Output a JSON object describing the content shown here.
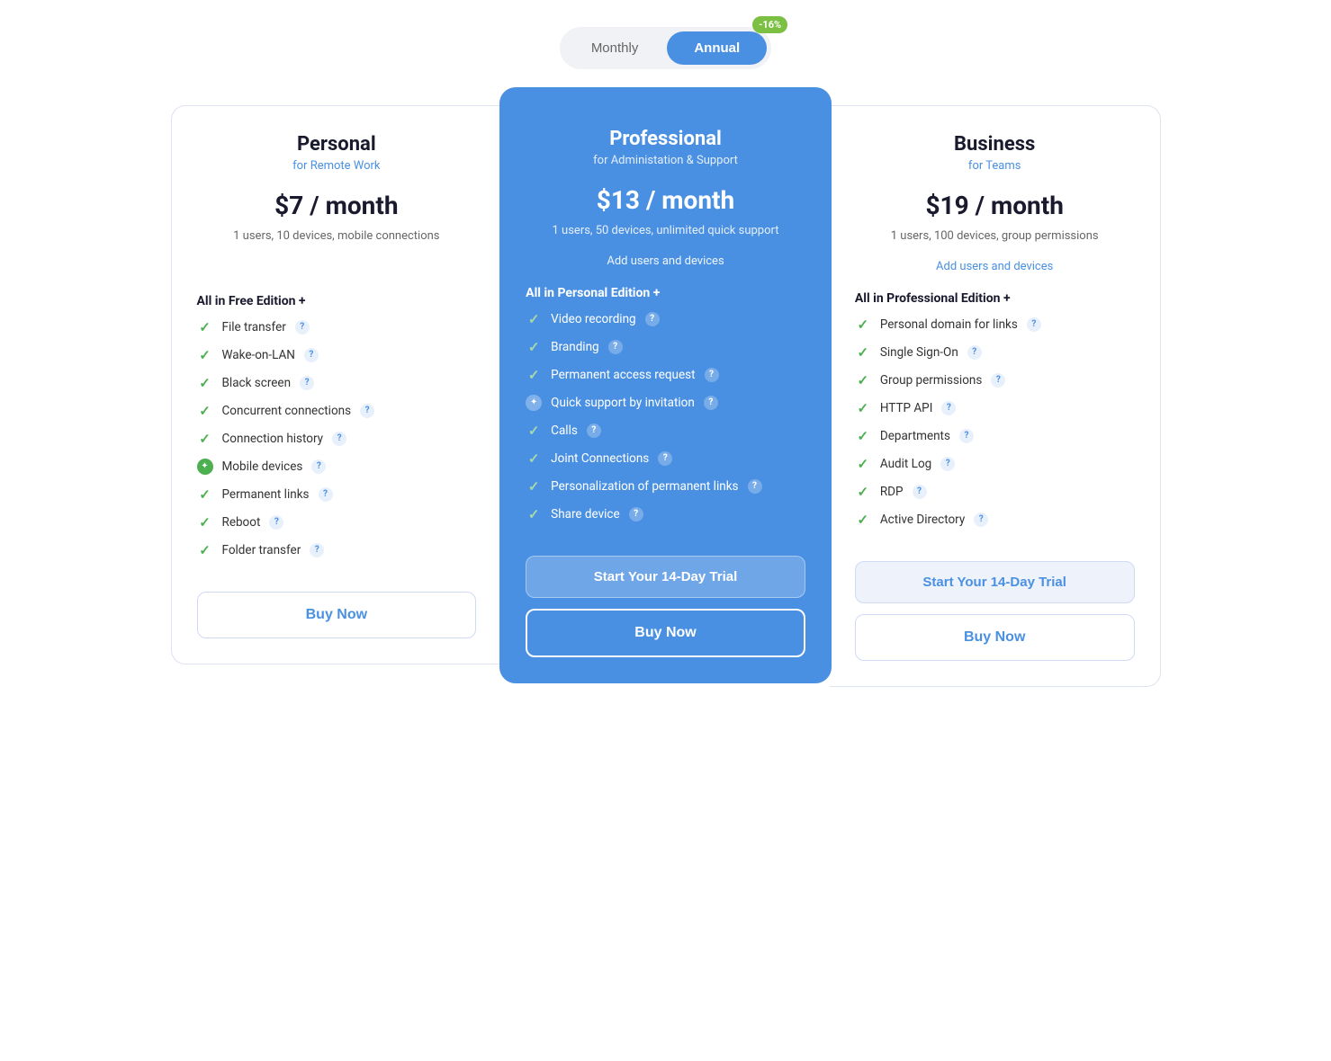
{
  "toggle": {
    "monthly_label": "Monthly",
    "annual_label": "Annual",
    "active": "annual",
    "discount_badge": "-16%"
  },
  "plans": [
    {
      "id": "personal",
      "name": "Personal",
      "subtitle": "for Remote Work",
      "price": "$7 / month",
      "description": "1 users, 10 devices, mobile connections",
      "add_users": null,
      "features_header": "All in Free Edition +",
      "features": [
        {
          "text": "File transfer",
          "icon": "check",
          "has_info": true
        },
        {
          "text": "Wake-on-LAN",
          "icon": "check",
          "has_info": true
        },
        {
          "text": "Black screen",
          "icon": "check",
          "has_info": true
        },
        {
          "text": "Concurrent connections",
          "icon": "check",
          "has_info": true
        },
        {
          "text": "Connection history",
          "icon": "check",
          "has_info": true
        },
        {
          "text": "Mobile devices",
          "icon": "star",
          "has_info": true
        },
        {
          "text": "Permanent links",
          "icon": "check",
          "has_info": true
        },
        {
          "text": "Reboot",
          "icon": "check",
          "has_info": true
        },
        {
          "text": "Folder transfer",
          "icon": "check",
          "has_info": true
        }
      ],
      "trial_label": null,
      "buy_label": "Buy Now"
    },
    {
      "id": "professional",
      "name": "Professional",
      "subtitle": "for Administation & Support",
      "price": "$13 / month",
      "description": "1 users, 50 devices, unlimited quick support",
      "add_users": "Add users and devices",
      "features_header": "All in Personal Edition +",
      "features": [
        {
          "text": "Video recording",
          "icon": "check",
          "has_info": true
        },
        {
          "text": "Branding",
          "icon": "check",
          "has_info": true
        },
        {
          "text": "Permanent access request",
          "icon": "check",
          "has_info": true
        },
        {
          "text": "Quick support by invitation",
          "icon": "star",
          "has_info": true
        },
        {
          "text": "Calls",
          "icon": "check",
          "has_info": true
        },
        {
          "text": "Joint Connections",
          "icon": "check",
          "has_info": true
        },
        {
          "text": "Personalization of permanent links",
          "icon": "check",
          "has_info": true
        },
        {
          "text": "Share device",
          "icon": "check",
          "has_info": true
        }
      ],
      "trial_label": "Start Your 14-Day Trial",
      "buy_label": "Buy Now"
    },
    {
      "id": "business",
      "name": "Business",
      "subtitle": "for Teams",
      "price": "$19 / month",
      "description": "1 users, 100 devices, group permissions",
      "add_users": "Add users and devices",
      "features_header": "All in Professional Edition +",
      "features": [
        {
          "text": "Personal domain for links",
          "icon": "check",
          "has_info": true
        },
        {
          "text": "Single Sign-On",
          "icon": "check",
          "has_info": true
        },
        {
          "text": "Group permissions",
          "icon": "check",
          "has_info": true
        },
        {
          "text": "HTTP API",
          "icon": "check",
          "has_info": true
        },
        {
          "text": "Departments",
          "icon": "check",
          "has_info": true
        },
        {
          "text": "Audit Log",
          "icon": "check",
          "has_info": true
        },
        {
          "text": "RDP",
          "icon": "check",
          "has_info": true
        },
        {
          "text": "Active Directory",
          "icon": "check",
          "has_info": true
        }
      ],
      "trial_label": "Start Your 14-Day Trial",
      "buy_label": "Buy Now"
    }
  ]
}
